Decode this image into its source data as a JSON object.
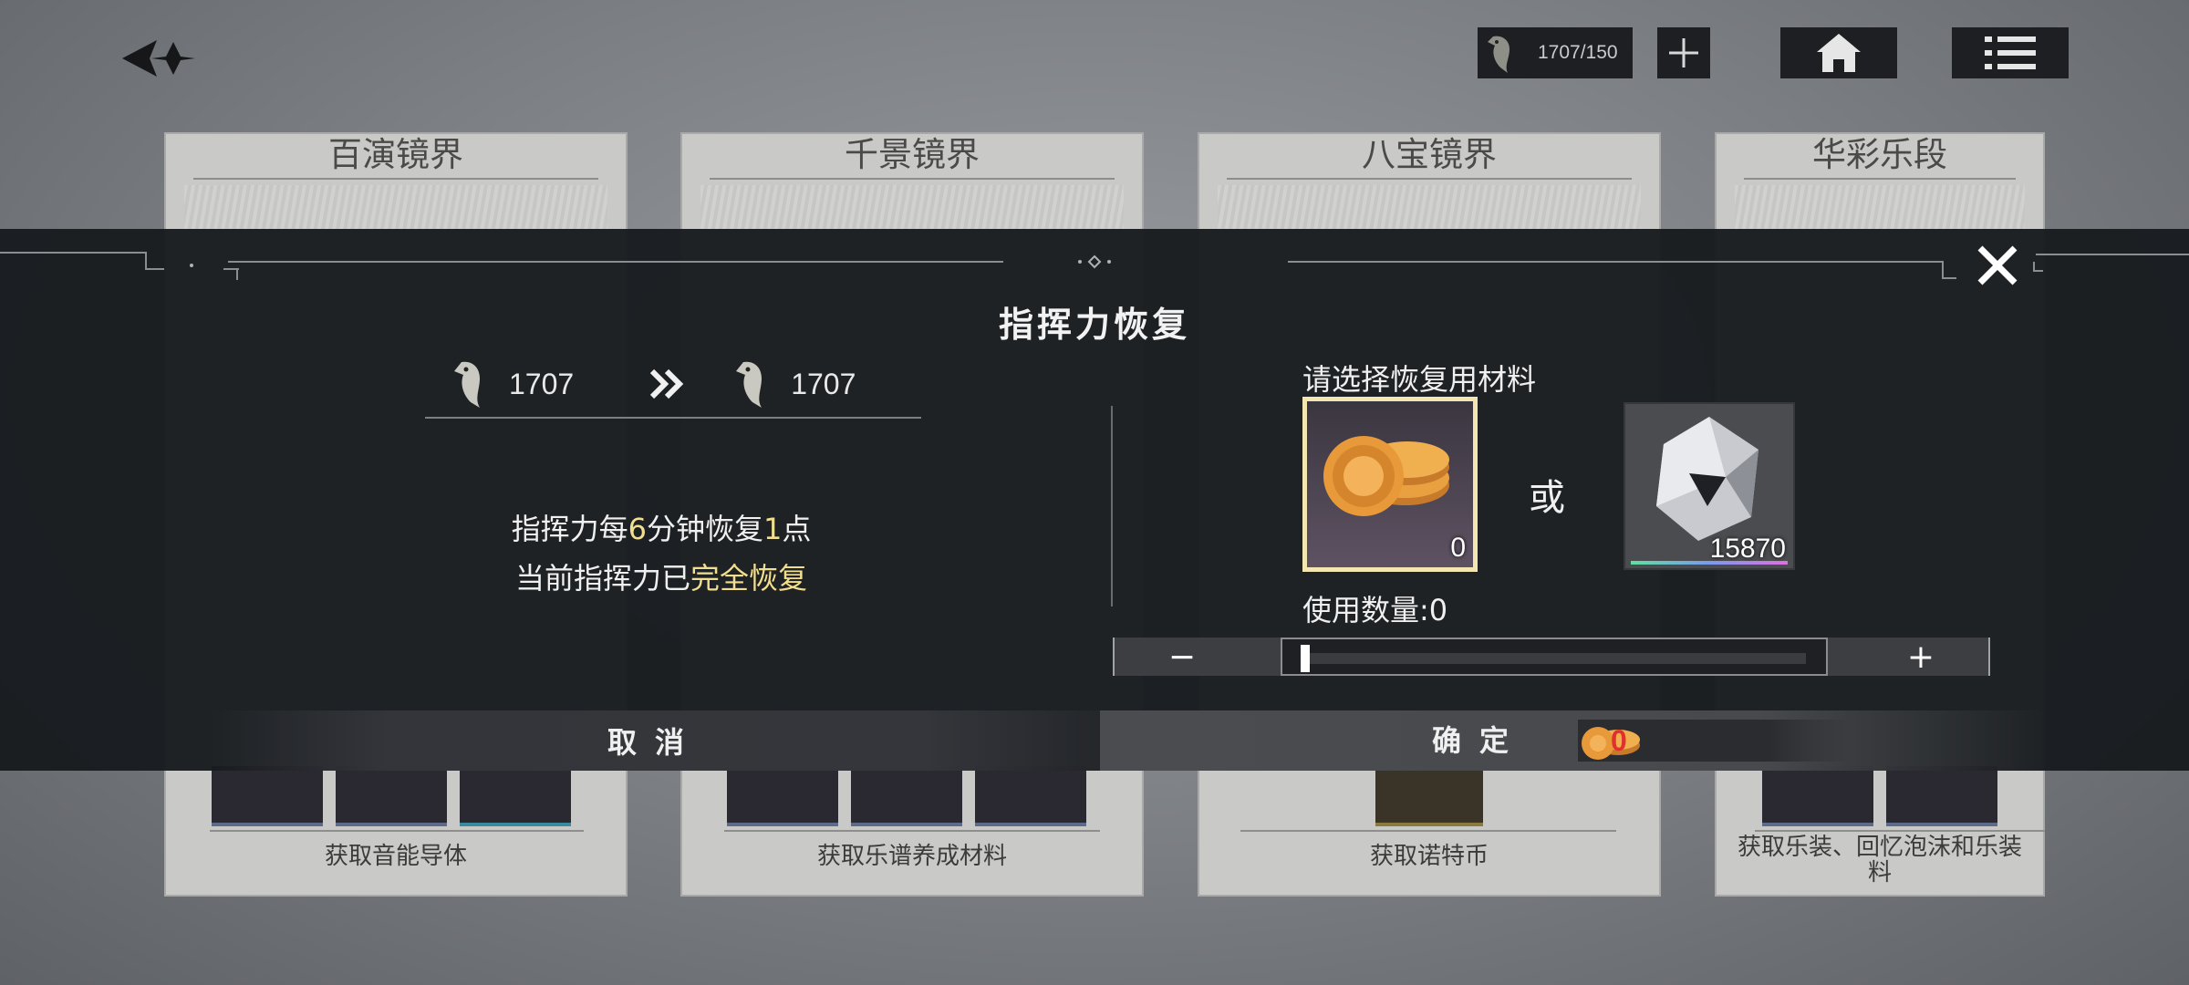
{
  "top_bar": {
    "stamina_display": "1707/150",
    "plus_icon": "plus-icon",
    "home_icon": "home-icon",
    "menu_icon": "menu-icon"
  },
  "cards": [
    {
      "title": "百演镜界",
      "link": "获取音能导体"
    },
    {
      "title": "千景镜界",
      "link": "获取乐谱养成材料"
    },
    {
      "title": "八宝镜界",
      "link": "获取诺特币"
    },
    {
      "title": "华彩乐段",
      "link": "获取乐装、回忆泡沫和乐装\n料"
    }
  ],
  "modal": {
    "title": "指挥力恢复",
    "current_value": "1707",
    "after_value": "1707",
    "info_line1": {
      "a": "指挥力每",
      "b": "6",
      "c": "分钟恢复",
      "d": "1",
      "e": "点"
    },
    "info_line2": {
      "a": "当前指挥力已",
      "b": "完全恢复"
    },
    "select_label": "请选择恢复用材料",
    "or_text": "或",
    "material_1": {
      "name": "biscuit",
      "count": "0"
    },
    "material_2": {
      "name": "crystal",
      "count": "15870"
    },
    "use_count_label": "使用数量:0",
    "minus_label": "−",
    "plus_label": "+",
    "slider_value": 0,
    "cancel_label": "取消",
    "confirm_label": "确定",
    "cost_value": "0",
    "accent_color": "#f1df8f",
    "cost_color": "#e0312c"
  }
}
